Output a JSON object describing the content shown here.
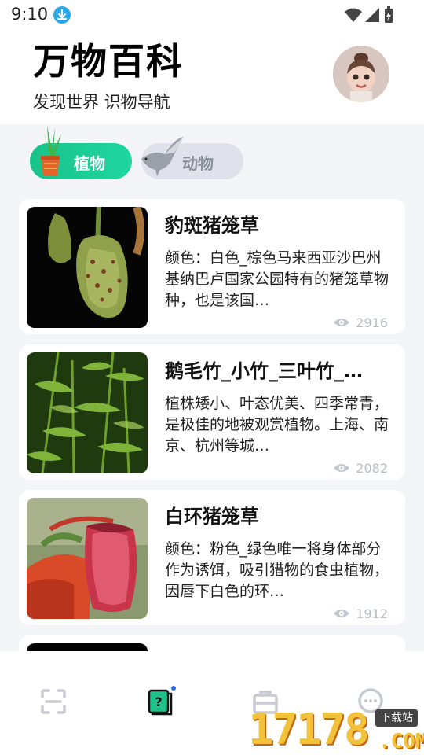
{
  "status": {
    "time": "9:10"
  },
  "header": {
    "title": "万物百科",
    "subtitle": "发现世界 识物导航"
  },
  "tabs": [
    {
      "label": "植物",
      "active": true
    },
    {
      "label": "动物",
      "active": false
    }
  ],
  "items": [
    {
      "title": "豹斑猪笼草",
      "desc": "颜色：白色_棕色马来西亚沙巴州基纳巴卢国家公园特有的猪笼草物种，也是该国…",
      "views": "2916"
    },
    {
      "title": "鹅毛竹_小竹_三叶竹_…",
      "desc": "植株矮小、叶态优美、四季常青，是极佳的地被观赏植物。上海、南京、杭州等城…",
      "views": "2082"
    },
    {
      "title": "白环猪笼草",
      "desc": "颜色：粉色_绿色唯一将身体部分作为诱饵，吸引猎物的食虫植物，因唇下白色的环…",
      "views": "1912"
    }
  ],
  "nav": [
    {
      "icon": "scan-icon"
    },
    {
      "icon": "encyclopedia-icon",
      "active": true
    },
    {
      "icon": "toolbox-icon"
    },
    {
      "icon": "chat-icon"
    }
  ],
  "watermark": {
    "number": "17178",
    "badge": "下载站",
    "suffix": ".COM"
  },
  "colors": {
    "accent": "#1fc68f",
    "inactive": "#dfe2ea",
    "background": "#f4f5f9"
  }
}
